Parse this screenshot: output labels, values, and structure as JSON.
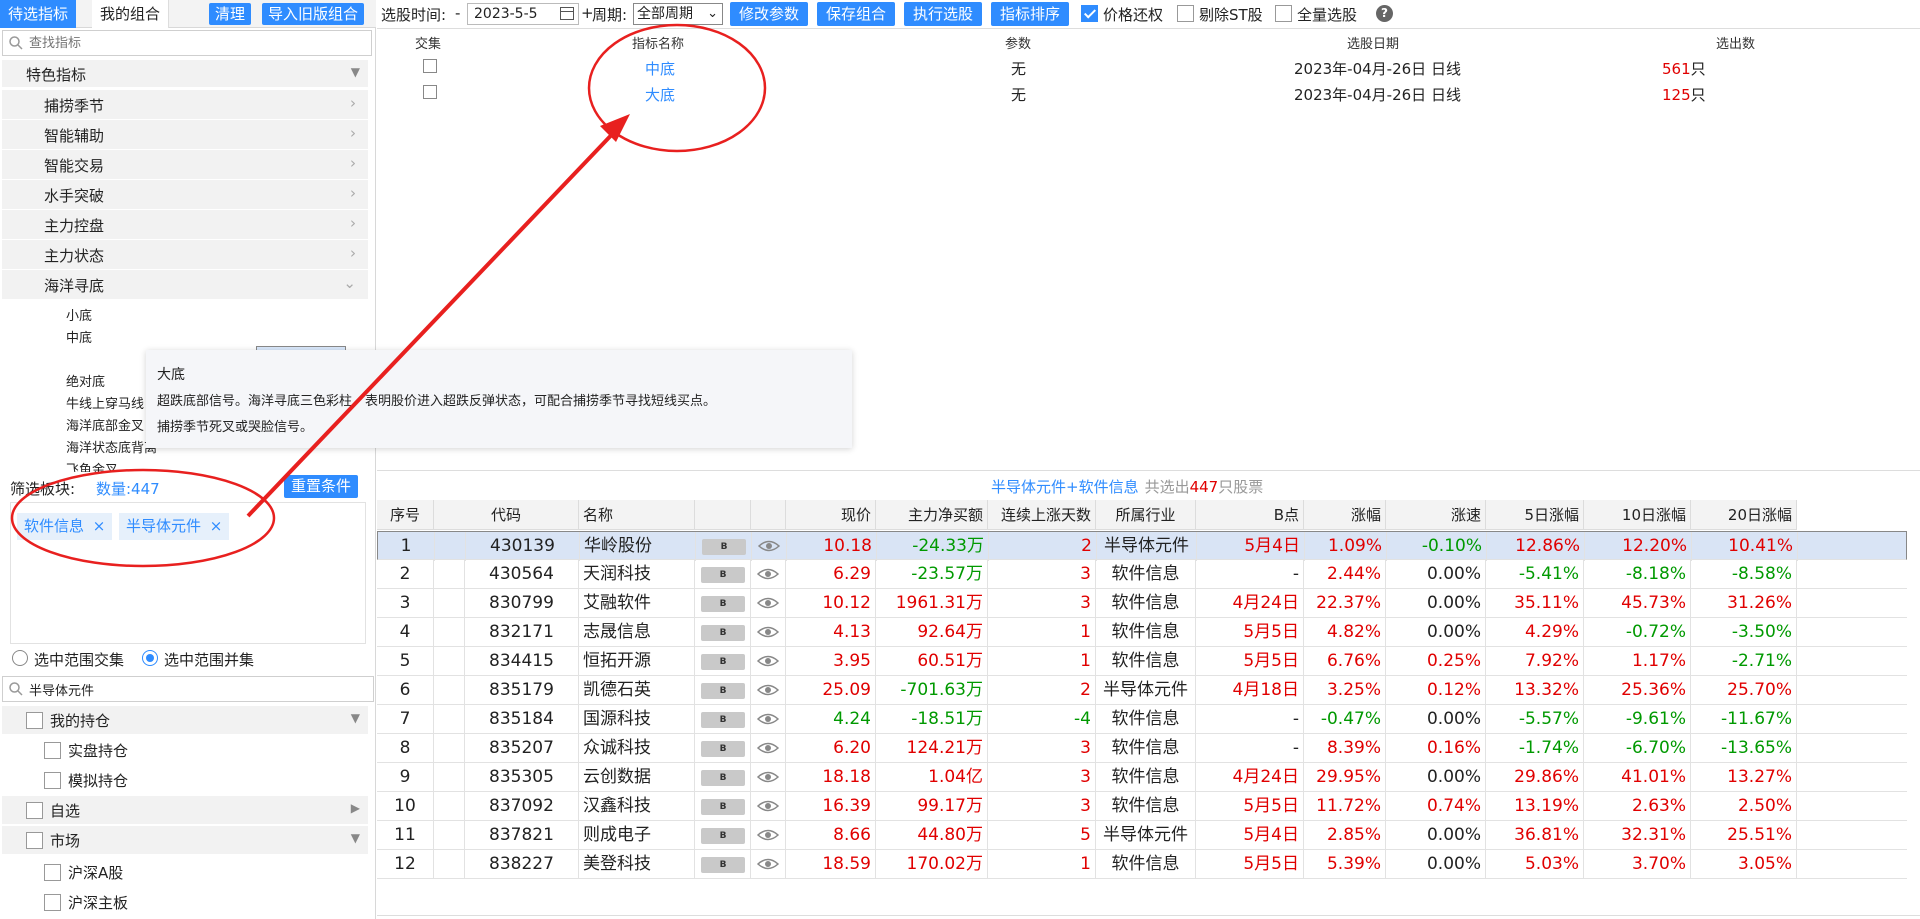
{
  "left": {
    "tabs": [
      "待选指标",
      "我的组合"
    ],
    "buttons": [
      "清理",
      "导入旧版组合"
    ],
    "search_placeholder": "查找指标",
    "tree": {
      "category": "特色指标",
      "subs": [
        "捕捞季节",
        "智能辅助",
        "智能交易",
        "水手突破",
        "主力控盘",
        "主力状态",
        "海洋寻底"
      ],
      "leaves": [
        "小底",
        "中底",
        "大底",
        "绝对底",
        "牛线上穿马线",
        "海洋底部金叉",
        "海洋状态底背离",
        "飞鱼金叉"
      ]
    },
    "tooltip": {
      "title": "大底",
      "line1": "超跌底部信号。海洋寻底三色彩柱，表明股价进入超跌反弹状态，可配合捕捞季节寻找短线买点。",
      "line2": "捕捞季节死叉或哭脸信号。"
    },
    "filter": {
      "label": "筛选板块:",
      "count": "数量:447",
      "reset": "重置条件",
      "tags": [
        "软件信息",
        "半导体元件"
      ],
      "tag_close": "×"
    },
    "radios": [
      "选中范围交集",
      "选中范围并集"
    ],
    "search2_value": "半导体元件",
    "groups": [
      {
        "label": "我的持仓",
        "arrow": "▼",
        "items": [
          "实盘持仓",
          "模拟持仓"
        ]
      },
      {
        "label": "自选",
        "arrow": "▶",
        "items": []
      },
      {
        "label": "市场",
        "arrow": "▼",
        "items": [
          "沪深A股",
          "沪深主板"
        ]
      }
    ]
  },
  "toolbar": {
    "time_label": "选股时间:",
    "minus": "-",
    "date": "2023-5-5",
    "plus": "+",
    "period_label": "周期:",
    "period_value": "全部周期",
    "buttons": [
      "修改参数",
      "保存组合",
      "执行选股",
      "指标排序"
    ],
    "checks": [
      "价格还权",
      "剔除ST股",
      "全量选股"
    ],
    "help": "?"
  },
  "indicators": {
    "headers": [
      "交集",
      "指标名称",
      "参数",
      "选股日期",
      "选出数"
    ],
    "rows": [
      {
        "name": "中底",
        "param": "无",
        "date": "2023年-04月-26日 日线",
        "count": "561",
        "unit": "只"
      },
      {
        "name": "大底",
        "param": "无",
        "date": "2023年-04月-26日 日线",
        "count": "125",
        "unit": "只"
      }
    ]
  },
  "results": {
    "caption_blue": "半导体元件+软件信息",
    "caption_pre": "共选出",
    "caption_num": "447",
    "caption_post": "只股票",
    "headers": [
      "序号",
      "代码",
      "名称",
      "",
      "",
      "现价",
      "主力净买额",
      "连续上涨天数",
      "所属行业",
      "B点",
      "涨幅",
      "涨速",
      "5日涨幅",
      "10日涨幅",
      "20日涨幅"
    ],
    "b_label": "B",
    "rows": [
      [
        "1",
        "430139",
        "华岭股份",
        "10.18",
        "-24.33万",
        "2",
        "半导体元件",
        "5月4日",
        "1.09%",
        "-0.10%",
        "12.86%",
        "12.20%",
        "10.41%"
      ],
      [
        "2",
        "430564",
        "天润科技",
        "6.29",
        "-23.57万",
        "3",
        "软件信息",
        "-",
        "2.44%",
        "0.00%",
        "-5.41%",
        "-8.18%",
        "-8.58%"
      ],
      [
        "3",
        "830799",
        "艾融软件",
        "10.12",
        "1961.31万",
        "3",
        "软件信息",
        "4月24日",
        "22.37%",
        "0.00%",
        "35.11%",
        "45.73%",
        "31.26%"
      ],
      [
        "4",
        "832171",
        "志晟信息",
        "4.13",
        "92.64万",
        "1",
        "软件信息",
        "5月5日",
        "4.82%",
        "0.00%",
        "4.29%",
        "-0.72%",
        "-3.50%"
      ],
      [
        "5",
        "834415",
        "恒拓开源",
        "3.95",
        "60.51万",
        "1",
        "软件信息",
        "5月5日",
        "6.76%",
        "0.25%",
        "7.92%",
        "1.17%",
        "-2.71%"
      ],
      [
        "6",
        "835179",
        "凯德石英",
        "25.09",
        "-701.63万",
        "2",
        "半导体元件",
        "4月18日",
        "3.25%",
        "0.12%",
        "13.32%",
        "25.36%",
        "25.70%"
      ],
      [
        "7",
        "835184",
        "国源科技",
        "4.24",
        "-18.51万",
        "-4",
        "软件信息",
        "-",
        "-0.47%",
        "0.00%",
        "-5.57%",
        "-9.61%",
        "-11.67%"
      ],
      [
        "8",
        "835207",
        "众诚科技",
        "6.20",
        "124.21万",
        "3",
        "软件信息",
        "-",
        "8.39%",
        "0.16%",
        "-1.74%",
        "-6.70%",
        "-13.65%"
      ],
      [
        "9",
        "835305",
        "云创数据",
        "18.18",
        "1.04亿",
        "3",
        "软件信息",
        "4月24日",
        "29.95%",
        "0.00%",
        "29.86%",
        "41.01%",
        "13.27%"
      ],
      [
        "10",
        "837092",
        "汉鑫科技",
        "16.39",
        "99.17万",
        "3",
        "软件信息",
        "5月5日",
        "11.72%",
        "0.74%",
        "13.19%",
        "2.63%",
        "2.50%"
      ],
      [
        "11",
        "837821",
        "则成电子",
        "8.66",
        "44.80万",
        "5",
        "半导体元件",
        "5月4日",
        "2.85%",
        "0.00%",
        "36.81%",
        "32.31%",
        "25.51%"
      ],
      [
        "12",
        "838227",
        "美登科技",
        "18.59",
        "170.02万",
        "1",
        "软件信息",
        "5月5日",
        "5.39%",
        "0.00%",
        "5.03%",
        "3.70%",
        "3.05%"
      ]
    ]
  },
  "colors": {
    "accent": "#2f8cff",
    "up": "#e00000",
    "down": "#009900",
    "annotation": "#e8201f"
  }
}
